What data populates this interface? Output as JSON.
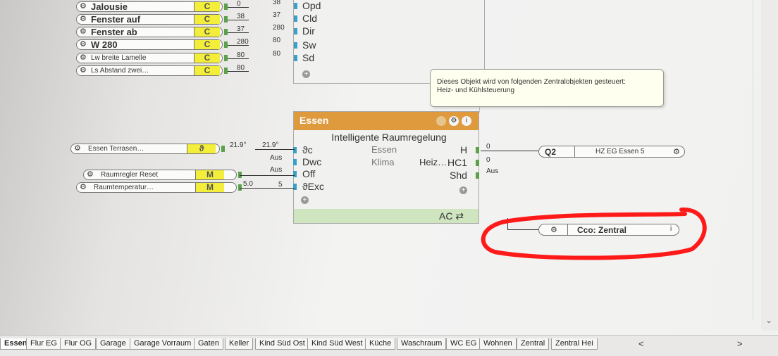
{
  "top_blocks": [
    {
      "label": "Jalousie",
      "type": "C",
      "value": "0",
      "out": "38",
      "big": true
    },
    {
      "label": "Fenster auf",
      "type": "C",
      "value": "38",
      "out": "37",
      "big": true
    },
    {
      "label": "Fenster ab",
      "type": "C",
      "value": "37",
      "out": "280",
      "big": true
    },
    {
      "label": "W 280",
      "type": "C",
      "value": "280",
      "out": "80",
      "big": true
    },
    {
      "label": "Lw breite Lamelle",
      "type": "C",
      "value": "80",
      "out": "80",
      "big": false
    },
    {
      "label": "Ls Abstand zwei…",
      "type": "C",
      "value": "80",
      "out": "",
      "big": false
    }
  ],
  "top_right_ports": [
    "Opd",
    "Cld",
    "Dir",
    "Sw",
    "Sd"
  ],
  "tooltip": {
    "line1": "Dieses Objekt wird von folgenden Zentralobjekten gesteuert:",
    "line2": "Heiz- und Kühlsteuerung"
  },
  "main_block": {
    "title": "Essen",
    "subtitle": "Intelligente Raumregelung",
    "inputs": [
      "ϑc",
      "Dwc",
      "Off",
      "ϑExc"
    ],
    "center_left": [
      "Essen",
      "Klima"
    ],
    "center_right": [
      "Heiz…"
    ],
    "outputs": [
      "H",
      "HC1",
      "Shd"
    ],
    "footer": "AC ⇄"
  },
  "left_inputs": [
    {
      "label": "Essen Terrasen…",
      "type": "ϑ",
      "value": "21.9°"
    },
    {
      "label": "Raumregler Reset",
      "type": "M",
      "value": ""
    },
    {
      "label": "Raumtemperatur…",
      "type": "M",
      "value": "5.0"
    }
  ],
  "wire_values": {
    "in_temp": "21.9°",
    "aus1": "Aus",
    "aus2": "Aus",
    "in_5": "5",
    "out_h": "0",
    "out_hc1": "0",
    "out_shd": "Aus"
  },
  "output_q2": {
    "label": "Q2",
    "name": "HZ EG Essen 5"
  },
  "output_cco": {
    "label": "Cco: Zentral"
  },
  "tabs": [
    {
      "label": "Essen",
      "active": true
    },
    {
      "label": "Flur EG",
      "active": false
    },
    {
      "label": "Flur OG",
      "active": false
    },
    {
      "label": "Garage",
      "active": false
    },
    {
      "label": "Garage Vorraum",
      "active": false
    },
    {
      "label": "Gaten",
      "active": false
    },
    {
      "label": "Keller",
      "active": false
    },
    {
      "label": "Kind Süd Ost",
      "active": false
    },
    {
      "label": "Kind Süd West",
      "active": false
    },
    {
      "label": "Küche",
      "active": false
    },
    {
      "label": "Waschraum",
      "active": false
    },
    {
      "label": "WC EG",
      "active": false
    },
    {
      "label": "Wohnen",
      "active": false
    },
    {
      "label": "Zentral",
      "active": false
    },
    {
      "label": "Zentral Hei",
      "active": false
    }
  ],
  "tab_nav": {
    "prev": "<",
    "next": ">"
  },
  "colors": {
    "header": "#df9a3e",
    "yellow": "#f3ee3a",
    "footer": "#cfe5c0",
    "red_mark": "#ff1a1a"
  }
}
